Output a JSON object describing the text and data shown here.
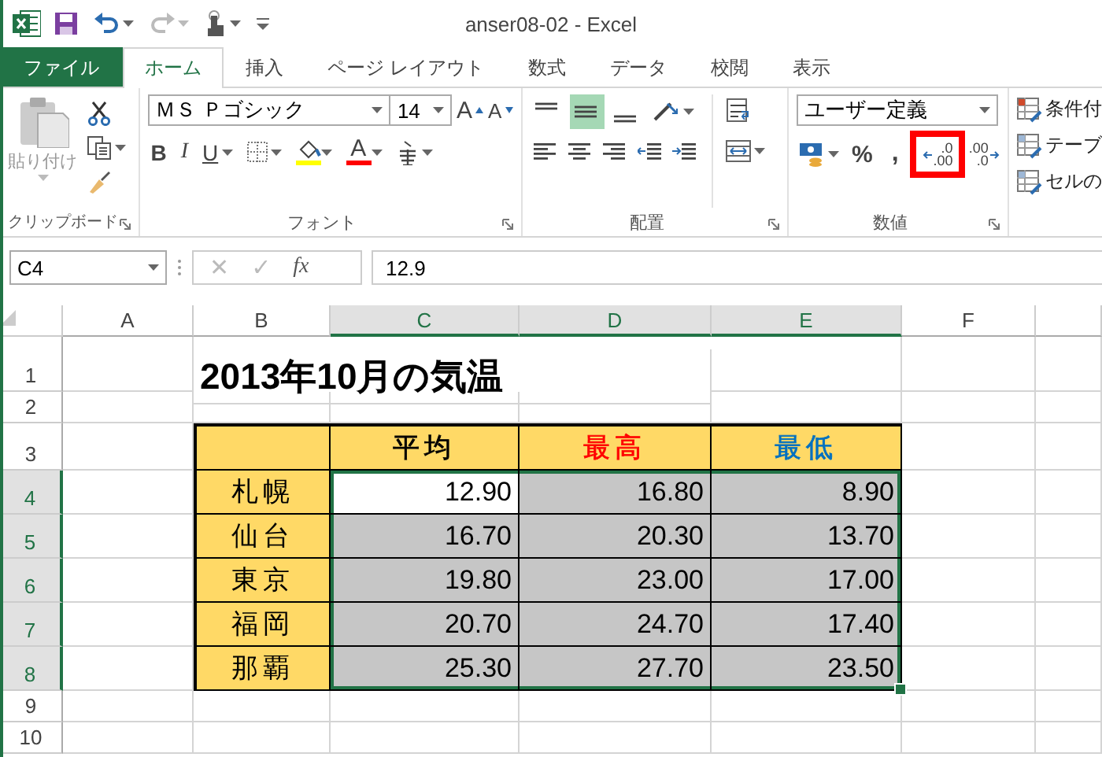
{
  "title_bar": {
    "title": "anser08-02 - Excel",
    "redo_disabled": true
  },
  "tabs": [
    {
      "label": "ファイル",
      "kind": "file",
      "selected": false
    },
    {
      "label": "ホーム",
      "kind": "tab",
      "selected": true
    },
    {
      "label": "挿入",
      "kind": "tab",
      "selected": false
    },
    {
      "label": "ページ レイアウト",
      "kind": "tab",
      "selected": false
    },
    {
      "label": "数式",
      "kind": "tab",
      "selected": false
    },
    {
      "label": "データ",
      "kind": "tab",
      "selected": false
    },
    {
      "label": "校閲",
      "kind": "tab",
      "selected": false
    },
    {
      "label": "表示",
      "kind": "tab",
      "selected": false
    }
  ],
  "ribbon": {
    "clipboard": {
      "label": "クリップボード",
      "paste_label": "貼り付け",
      "paste_disabled": true
    },
    "font": {
      "label": "フォント",
      "font_name": "ＭＳ Ｐゴシック",
      "font_size": "14",
      "grow": "A",
      "shrink": "A",
      "bold": "B",
      "italic": "I",
      "underline": "U",
      "font_color": "A"
    },
    "alignment": {
      "label": "配置",
      "vertical": [
        {
          "selected": false
        },
        {
          "selected": true
        },
        {
          "selected": false
        }
      ]
    },
    "number": {
      "label": "数値",
      "format": "ユーザー定義",
      "percent": "%",
      "comma": ",",
      "decimals": [
        {
          "kind": "increase",
          "top": ".0",
          "bottom": ".00",
          "highlighted": true
        },
        {
          "kind": "decrease",
          "top": ".00",
          "bottom": ".0",
          "highlighted": false
        }
      ]
    },
    "styles": {
      "items": [
        "条件付",
        "テーブ",
        "セルの"
      ]
    }
  },
  "formula_bar": {
    "name_box": "C4",
    "cancel": "✕",
    "enter": "✓",
    "function": "fx",
    "formula": "12.9",
    "buttons_disabled": true
  },
  "sheet": {
    "columns": [
      {
        "label": "A",
        "selected": false
      },
      {
        "label": "B",
        "selected": false
      },
      {
        "label": "C",
        "selected": true
      },
      {
        "label": "D",
        "selected": true
      },
      {
        "label": "E",
        "selected": true
      },
      {
        "label": "F",
        "selected": false
      }
    ],
    "rows": [
      {
        "label": "1",
        "selected": false,
        "cells": [
          {
            "kind": "title",
            "text": "2013年10月の気温"
          }
        ]
      },
      {
        "label": "2",
        "selected": false
      },
      {
        "label": "3",
        "selected": false,
        "cells": [
          {
            "kind": "header"
          },
          {
            "kind": "header",
            "text": "平均",
            "color": "#000000"
          },
          {
            "kind": "header",
            "text": "最高",
            "color": "#ff0000"
          },
          {
            "kind": "header",
            "text": "最低",
            "color": "#0070c0"
          }
        ]
      },
      {
        "label": "4",
        "selected": true,
        "cells": [
          {
            "kind": "label",
            "text": "札幌"
          },
          {
            "kind": "number",
            "text": "12.90",
            "selected": true,
            "active": true
          },
          {
            "kind": "number",
            "text": "16.80",
            "selected": true,
            "active": false
          },
          {
            "kind": "number",
            "text": "8.90",
            "selected": true,
            "active": false
          }
        ]
      },
      {
        "label": "5",
        "selected": true,
        "cells": [
          {
            "kind": "label",
            "text": "仙台"
          },
          {
            "kind": "number",
            "text": "16.70",
            "selected": true,
            "active": false
          },
          {
            "kind": "number",
            "text": "20.30",
            "selected": true,
            "active": false
          },
          {
            "kind": "number",
            "text": "13.70",
            "selected": true,
            "active": false
          }
        ]
      },
      {
        "label": "6",
        "selected": true,
        "cells": [
          {
            "kind": "label",
            "text": "東京"
          },
          {
            "kind": "number",
            "text": "19.80",
            "selected": true,
            "active": false
          },
          {
            "kind": "number",
            "text": "23.00",
            "selected": true,
            "active": false
          },
          {
            "kind": "number",
            "text": "17.00",
            "selected": true,
            "active": false
          }
        ]
      },
      {
        "label": "7",
        "selected": true,
        "cells": [
          {
            "kind": "label",
            "text": "福岡"
          },
          {
            "kind": "number",
            "text": "20.70",
            "selected": true,
            "active": false
          },
          {
            "kind": "number",
            "text": "24.70",
            "selected": true,
            "active": false
          },
          {
            "kind": "number",
            "text": "17.40",
            "selected": true,
            "active": false
          }
        ]
      },
      {
        "label": "8",
        "selected": true,
        "cells": [
          {
            "kind": "label",
            "text": "那覇"
          },
          {
            "kind": "number",
            "text": "25.30",
            "selected": true,
            "active": false
          },
          {
            "kind": "number",
            "text": "27.70",
            "selected": true,
            "active": false
          },
          {
            "kind": "number",
            "text": "23.50",
            "selected": true,
            "active": false
          }
        ]
      },
      {
        "label": "9",
        "selected": false
      },
      {
        "label": "10",
        "selected": false
      }
    ]
  }
}
